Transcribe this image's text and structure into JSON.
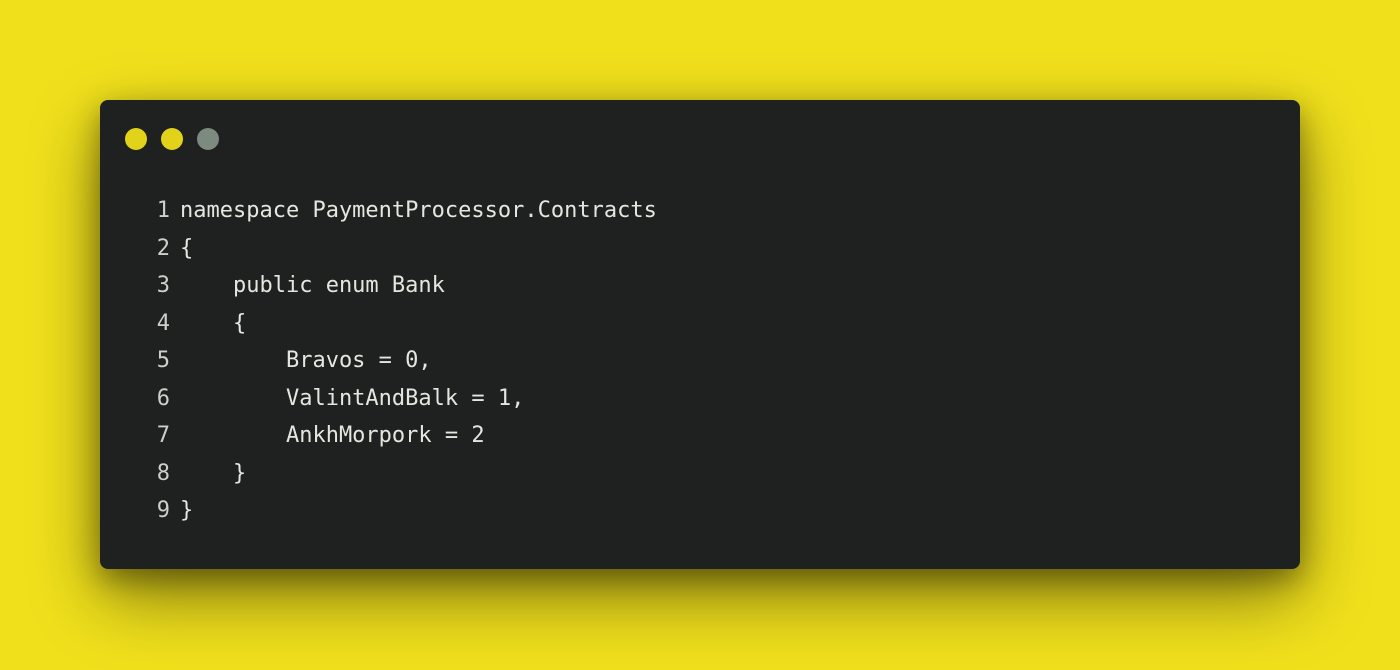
{
  "window": {
    "controls": [
      {
        "name": "close",
        "color": "#e3d21a"
      },
      {
        "name": "minimize",
        "color": "#e3d21a"
      },
      {
        "name": "maximize",
        "color": "#7d8a80"
      }
    ]
  },
  "code": {
    "lines": [
      {
        "number": "1",
        "text": "namespace PaymentProcessor.Contracts"
      },
      {
        "number": "2",
        "text": "{"
      },
      {
        "number": "3",
        "text": "    public enum Bank"
      },
      {
        "number": "4",
        "text": "    {"
      },
      {
        "number": "5",
        "text": "        Bravos = 0,"
      },
      {
        "number": "6",
        "text": "        ValintAndBalk = 1,"
      },
      {
        "number": "7",
        "text": "        AnkhMorpork = 2"
      },
      {
        "number": "8",
        "text": "    }"
      },
      {
        "number": "9",
        "text": "}"
      }
    ]
  },
  "colors": {
    "background": "#f0e01c",
    "window": "#1f2120",
    "text": "#e6e6e1"
  }
}
